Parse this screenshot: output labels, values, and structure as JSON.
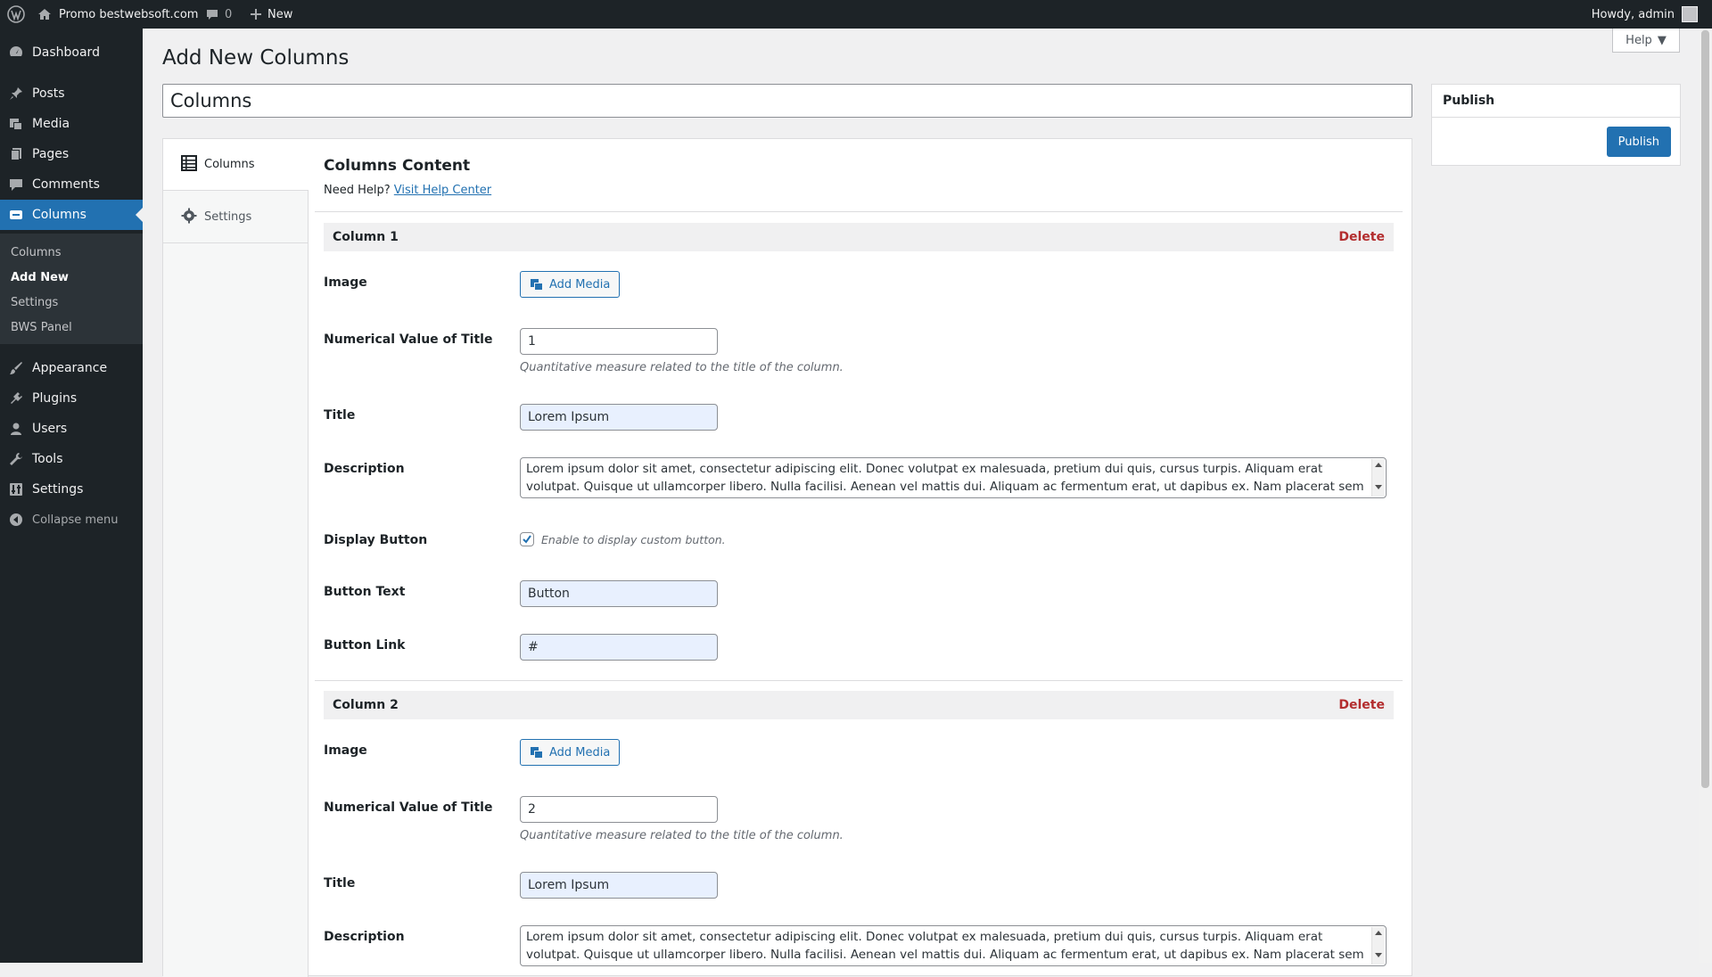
{
  "adminbar": {
    "site_name": "Promo bestwebsoft.com",
    "comments_count": "0",
    "new_label": "New",
    "howdy": "Howdy, admin"
  },
  "sidebar": {
    "items": [
      {
        "label": "Dashboard",
        "icon": "dashboard-icon"
      },
      {
        "label": "Posts",
        "icon": "pin-icon"
      },
      {
        "label": "Media",
        "icon": "media-icon"
      },
      {
        "label": "Pages",
        "icon": "pages-icon"
      },
      {
        "label": "Comments",
        "icon": "comments-icon"
      },
      {
        "label": "Columns",
        "icon": "columns-icon",
        "current": true
      },
      {
        "label": "Appearance",
        "icon": "brush-icon"
      },
      {
        "label": "Plugins",
        "icon": "plugins-icon"
      },
      {
        "label": "Users",
        "icon": "users-icon"
      },
      {
        "label": "Tools",
        "icon": "wrench-icon"
      },
      {
        "label": "Settings",
        "icon": "settings-icon"
      }
    ],
    "submenu": [
      "Columns",
      "Add New",
      "Settings",
      "BWS Panel"
    ],
    "collapse": "Collapse menu"
  },
  "help_label": "Help",
  "page": {
    "title": "Add New Columns",
    "post_title_value": "Columns"
  },
  "tabs": [
    {
      "label": "Columns",
      "icon": "table-icon"
    },
    {
      "label": "Settings",
      "icon": "gear-icon"
    }
  ],
  "content": {
    "heading": "Columns Content",
    "need_help": "Need Help?",
    "help_link": "Visit Help Center",
    "delete_label": "Delete",
    "add_media_label": "Add Media",
    "labels": {
      "image": "Image",
      "numerical": "Numerical Value of Title",
      "title": "Title",
      "description": "Description",
      "display_button": "Display Button",
      "button_text": "Button Text",
      "button_link": "Button Link"
    },
    "numerical_desc": "Quantitative measure related to the title of the column.",
    "display_button_desc": "Enable to display custom button.",
    "columns": [
      {
        "header": "Column 1",
        "numerical": "1",
        "title": "Lorem Ipsum",
        "description": "Lorem ipsum dolor sit amet, consectetur adipiscing elit. Donec volutpat ex malesuada, pretium dui quis, cursus turpis. Aliquam erat volutpat. Quisque ut ullamcorper libero. Nulla facilisi. Aenean vel mattis dui. Aliquam ac fermentum erat, ut dapibus ex. Nam placerat sem vel ipsum mattis",
        "display_button": true,
        "button_text": "Button",
        "button_link": "#"
      },
      {
        "header": "Column 2",
        "numerical": "2",
        "title": "Lorem Ipsum",
        "description": "Lorem ipsum dolor sit amet, consectetur adipiscing elit. Donec volutpat ex malesuada, pretium dui quis, cursus turpis. Aliquam erat volutpat. Quisque ut ullamcorper libero. Nulla facilisi. Aenean vel mattis dui. Aliquam ac fermentum erat, ut dapibus ex. Nam placerat sem vel ipsum mattis"
      }
    ]
  },
  "publish": {
    "heading": "Publish",
    "button": "Publish"
  },
  "colors": {
    "accent": "#2271b1",
    "admin_dark": "#1d2327",
    "delete": "#b32d2e"
  }
}
